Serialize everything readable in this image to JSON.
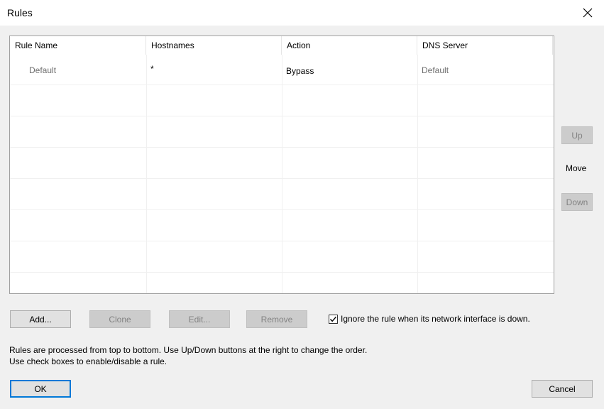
{
  "window": {
    "title": "Rules"
  },
  "table": {
    "columns": [
      "Rule Name",
      "Hostnames",
      "Action",
      "DNS Server"
    ],
    "rows": [
      {
        "rule_name": "Default",
        "hostnames": "*",
        "action": "Bypass",
        "dns_server": "Default"
      }
    ]
  },
  "side": {
    "up_label": "Up",
    "move_label": "Move",
    "down_label": "Down"
  },
  "buttons": {
    "add_label": "Add...",
    "clone_label": "Clone",
    "edit_label": "Edit...",
    "remove_label": "Remove"
  },
  "checkbox": {
    "label": "Ignore the rule when its network interface is down.",
    "checked": true
  },
  "info": {
    "line1": "Rules are processed from top to bottom. Use Up/Down buttons at the right to change the order.",
    "line2": "Use check boxes to enable/disable a rule."
  },
  "footer": {
    "ok_label": "OK",
    "cancel_label": "Cancel"
  }
}
